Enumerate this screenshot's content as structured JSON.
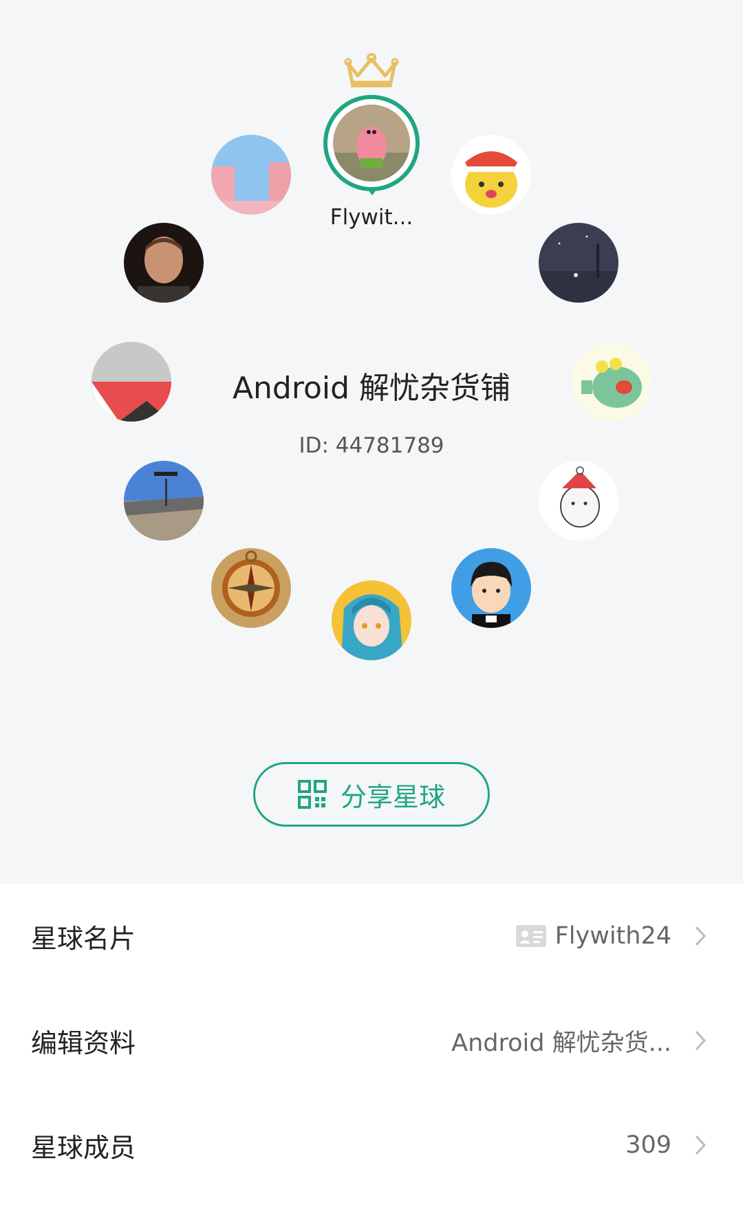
{
  "group": {
    "name": "Android 解忧杂货铺",
    "id_text": "ID: 44781789",
    "owner_name": "Flywit..."
  },
  "share_button": {
    "label": "分享星球",
    "icon": "qr-code-icon"
  },
  "settings": [
    {
      "label": "星球名片",
      "value": "Flywith24",
      "icon": "id-card-icon"
    },
    {
      "label": "编辑资料",
      "value": "Android 解忧杂货..."
    },
    {
      "label": "星球成员",
      "value": "309"
    }
  ],
  "colors": {
    "accent": "#20a67f",
    "crown": "#e8bf63",
    "top_background": "#f4f6f8"
  }
}
